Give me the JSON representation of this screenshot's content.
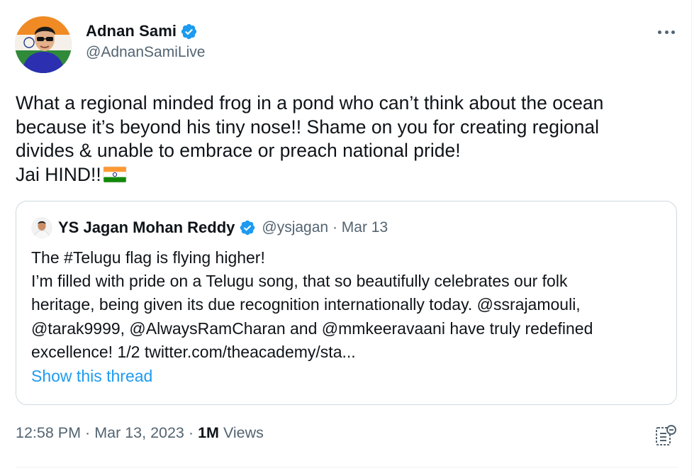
{
  "author": {
    "name": "Adnan Sami",
    "handle": "@AdnanSamiLive"
  },
  "tweet": {
    "lines": [
      "What a regional minded frog in a pond who can’t think about the ocean",
      "because it’s beyond his tiny nose!! Shame on you for creating regional",
      "divides & unable to embrace or preach national pride!",
      "Jai HIND!!"
    ],
    "emoji": "india-flag"
  },
  "quoted": {
    "name": "YS Jagan Mohan Reddy",
    "handle": "@ysjagan",
    "separator": "·",
    "date": "Mar 13",
    "lines": [
      "The #Telugu flag is flying higher!",
      "I’m filled with pride on a Telugu song, that so beautifully celebrates our folk",
      "heritage, being given its due recognition internationally today. @ssrajamouli,",
      "@tarak9999, @AlwaysRamCharan and @mmkeeravaani have truly redefined",
      "excellence! 1/2 twitter.com/theacademy/sta..."
    ],
    "show_thread": "Show this thread"
  },
  "meta": {
    "time": "12:58 PM",
    "separator": "·",
    "date": "Mar 13, 2023",
    "views_count": "1M",
    "views_label": "Views"
  },
  "colors": {
    "text": "#0f1419",
    "secondary": "#536471",
    "link": "#1d9bf0",
    "verified": "#1d9bf0",
    "border": "#cfd9de"
  },
  "icons": {
    "verified": "verified-badge-icon",
    "more": "more-options-icon",
    "analytics": "analytics-icon"
  }
}
